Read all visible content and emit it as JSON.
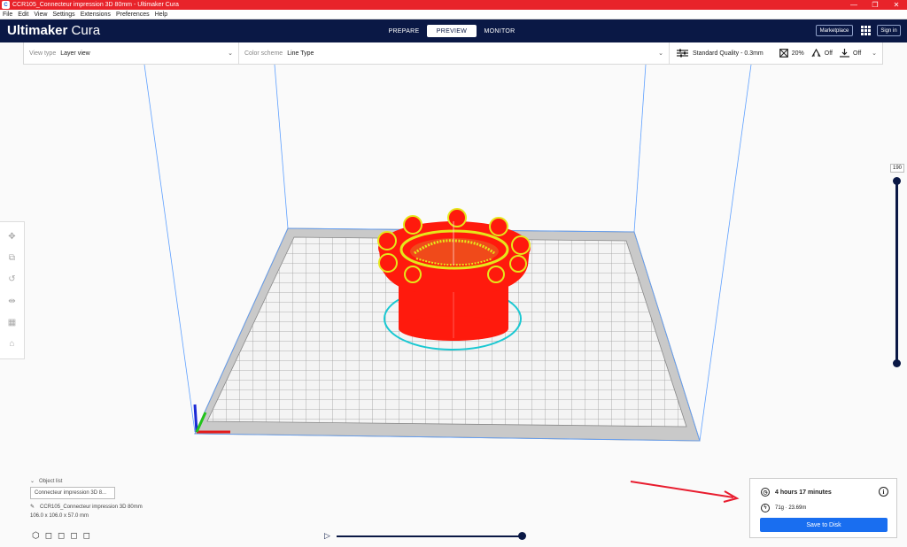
{
  "window": {
    "title": "CCR105_Connecteur impression 3D 80mm - Ultimaker Cura",
    "controls": [
      "—",
      "❐",
      "✕"
    ]
  },
  "menu": [
    "File",
    "Edit",
    "View",
    "Settings",
    "Extensions",
    "Preferences",
    "Help"
  ],
  "header": {
    "logo_bold": "Ultimaker",
    "logo_light": " Cura",
    "tabs": [
      "PREPARE",
      "PREVIEW",
      "MONITOR"
    ],
    "active_tab": "PREVIEW",
    "marketplace": "Marketplace",
    "sign_in": "Sign in"
  },
  "toolbar": {
    "view_type_label": "View type",
    "view_type_value": "Layer view",
    "color_scheme_label": "Color scheme",
    "color_scheme_value": "Line Type",
    "quality": "Standard Quality - 0.3mm",
    "infill": "20%",
    "support": "Off",
    "adhesion": "Off"
  },
  "layer_slider": {
    "max_layer": "190"
  },
  "object_list": {
    "toggle_label": "Object list",
    "item": "Connecteur impression 3D 8...",
    "job_name": "CCR105_Connecteur impression 3D 80mm",
    "dimensions": "106.0 x 106.0 x 57.0 mm"
  },
  "print_info": {
    "time": "4 hours 17 minutes",
    "material": "71g · 23.69m",
    "save_label": "Save to Disk"
  },
  "colors": {
    "brand_dark": "#0a1845",
    "titlebar": "#e8232a",
    "accent_blue": "#196ef0",
    "model_red": "#ff1a0d",
    "infill_yellow": "#e6e61a",
    "skirt_cyan": "#19c8d2",
    "annotation_arrow": "#e81c2e"
  }
}
